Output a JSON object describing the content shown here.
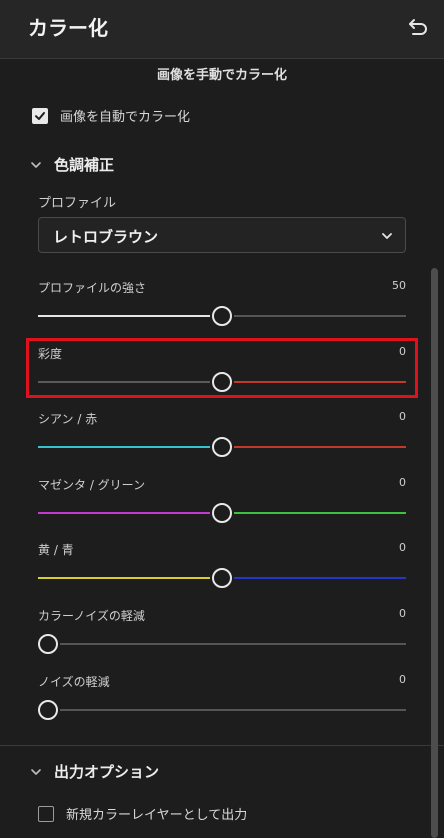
{
  "header": {
    "title": "カラー化"
  },
  "manual_title": "画像を手動でカラー化",
  "auto_checkbox": {
    "label": "画像を自動でカラー化",
    "checked": true
  },
  "color_correction": {
    "section_label": "色調補正",
    "profile_label": "プロファイル",
    "profile_value": "レトロブラウン",
    "sliders": [
      {
        "label": "プロファイルの強さ",
        "value": "50",
        "level": 0.5
      },
      {
        "label": "彩度",
        "value": "0",
        "level": 0.5
      },
      {
        "label": "シアン / 赤",
        "value": "0",
        "level": 0.5
      },
      {
        "label": "マゼンタ / グリーン",
        "value": "0",
        "level": 0.5
      },
      {
        "label": "黄 / 青",
        "value": "0",
        "level": 0.5
      },
      {
        "label": "カラーノイズの軽減",
        "value": "0",
        "level": 0
      },
      {
        "label": "ノイズの軽減",
        "value": "0",
        "level": 0
      }
    ]
  },
  "output_options": {
    "section_label": "出力オプション",
    "new_layer_checkbox": {
      "label": "新規カラーレイヤーとして出力",
      "checked": false
    }
  },
  "colors": {
    "highlight": "#e0111a",
    "cyan": "#35c4cf",
    "red": "#c0392b",
    "magenta": "#c13bd1",
    "green": "#3ec23e",
    "yellow": "#d8cf2e",
    "blue": "#2437c8"
  }
}
